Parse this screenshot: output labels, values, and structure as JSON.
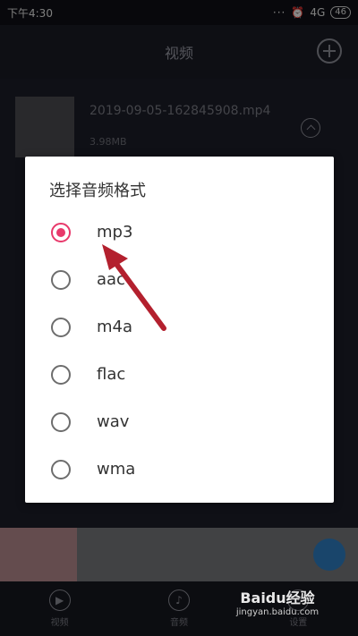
{
  "status_bar": {
    "time": "下午4:30",
    "dots": "···",
    "alarm_icon": "alarm-icon",
    "network": "4G",
    "battery": "46"
  },
  "app_header": {
    "title": "视频"
  },
  "file_item": {
    "name": "2019-09-05-162845908.mp4",
    "size": "3.98MB"
  },
  "dialog": {
    "title": "选择音频格式",
    "options": [
      {
        "label": "mp3",
        "checked": true
      },
      {
        "label": "aac",
        "checked": false
      },
      {
        "label": "m4a",
        "checked": false
      },
      {
        "label": "flac",
        "checked": false
      },
      {
        "label": "wav",
        "checked": false
      },
      {
        "label": "wma",
        "checked": false
      }
    ]
  },
  "bottom_nav": {
    "items": [
      {
        "label": "视频",
        "icon": "play-icon"
      },
      {
        "label": "音频",
        "icon": "music-note-icon"
      },
      {
        "label": "设置",
        "icon": "gear-icon"
      }
    ]
  },
  "watermark": {
    "top": "Baidu经验",
    "bottom": "jingyan.baidu.com"
  },
  "colors": {
    "accent": "#e8396b",
    "arrow": "#b3202e"
  }
}
